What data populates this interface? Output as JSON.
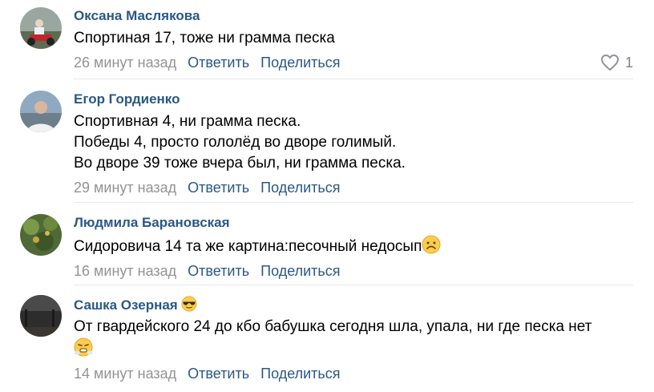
{
  "comments": [
    {
      "author": "Оксана Маслякова",
      "lines": [
        "Спортиная 17, тоже ни грамма песка"
      ],
      "time": "26 минут назад",
      "reply_label": "Ответить",
      "share_label": "Поделиться",
      "likes": "1",
      "like_icon": "heart-outline"
    },
    {
      "author": "Егор Гордиенко",
      "lines": [
        "Спортивная 4, ни грамма песка.",
        "Победы 4, просто гололёд во дворе голимый.",
        "Во дворе 39 тоже вчера был, ни грамма песка."
      ],
      "time": "29 минут назад",
      "reply_label": "Ответить",
      "share_label": "Поделиться"
    },
    {
      "author": "Людмила Барановская",
      "lines": [
        "Сидоровича 14 та же картина:песочный недосып"
      ],
      "inline_emoji": "frowning-face",
      "time": "16 минут назад",
      "reply_label": "Ответить",
      "share_label": "Поделиться"
    },
    {
      "author": "Сашка Озерная",
      "author_emoji": "sunglasses-face",
      "lines": [
        "От гвардейского 24 до кбо бабушка сегодня шла, упала, ни где песка нет"
      ],
      "second_line_emoji": "face-with-steam",
      "time": "14 минут назад",
      "reply_label": "Ответить",
      "share_label": "Поделиться"
    }
  ],
  "colors": {
    "author": "#2a5885",
    "link": "#2a5885",
    "meta": "#939393",
    "divider": "#e7e8ec"
  }
}
